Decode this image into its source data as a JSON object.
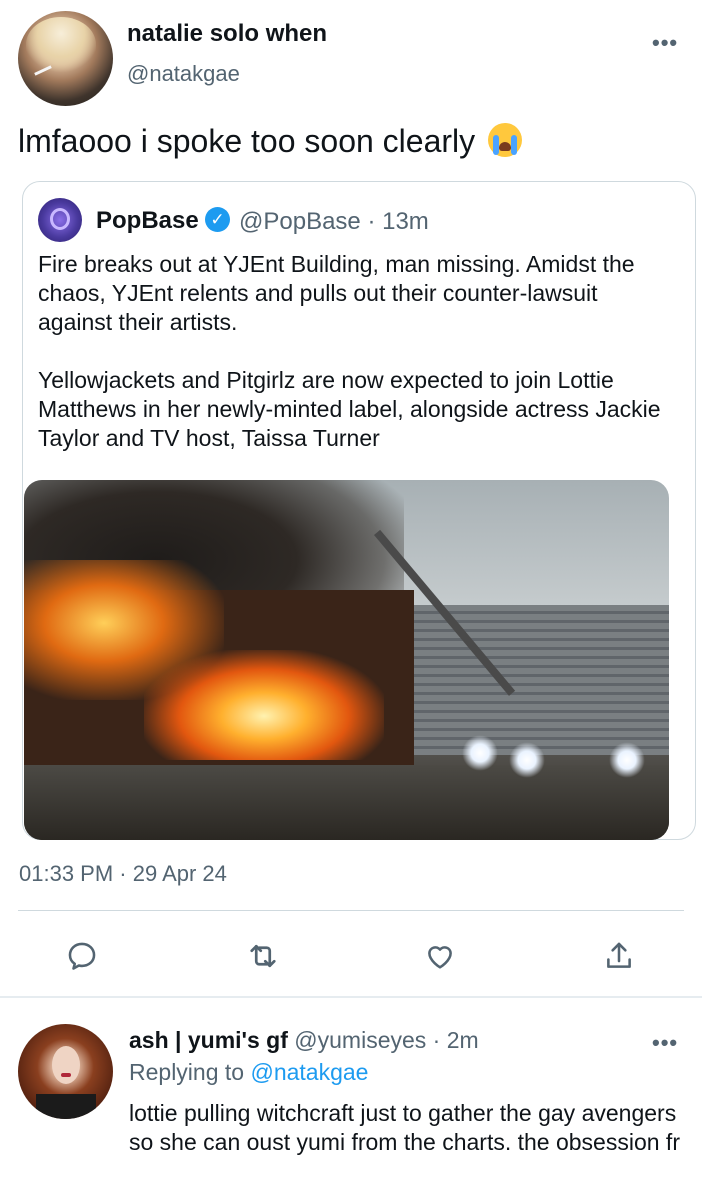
{
  "tweet": {
    "display_name": "natalie solo when",
    "handle": "@natakgae",
    "text": "lmfaooo i spoke too soon clearly",
    "emoji": "loudly-crying-face",
    "timestamp": "01:33 PM · 29 Apr 24",
    "more_icon": "more-horizontal-icon"
  },
  "quote": {
    "display_name": "PopBase",
    "verified": true,
    "handle_time": "@PopBase · 13m",
    "paragraph_1": "Fire breaks out at YJEnt Building, man missing. Amidst the chaos, YJEnt relents and pulls out their counter-lawsuit against their artists.",
    "paragraph_2": "Yellowjackets and Pitgirlz are now expected to join Lottie Matthews in her newly-minted label, alongside actress Jackie Taylor and TV host, Taissa Turner"
  },
  "actions": [
    {
      "name": "reply-icon"
    },
    {
      "name": "retweet-icon"
    },
    {
      "name": "like-icon"
    },
    {
      "name": "share-icon"
    }
  ],
  "reply": {
    "display_name": "ash | yumi's gf",
    "handle_time": "@yumiseyes · 2m",
    "replying_label": "Replying to",
    "replying_to": "@natakgae",
    "text": "lottie pulling witchcraft just to gather the gay avengers so she can oust yumi from the charts. the obsession fr"
  },
  "colors": {
    "accent": "#1d9bf0",
    "secondary_text": "#536471",
    "border": "#cfd9de"
  }
}
